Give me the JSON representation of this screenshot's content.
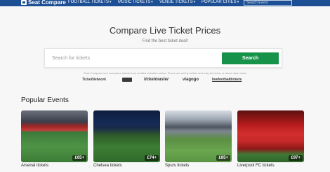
{
  "nav": {
    "logo": "Seat Compare",
    "items": [
      {
        "label": "FOOTBALL TICKETS"
      },
      {
        "label": "MUSIC TICKETS"
      },
      {
        "label": "VENUE TICKETS"
      },
      {
        "label": "POPULAR CITIES"
      }
    ],
    "search_placeholder": "Search Event"
  },
  "hero": {
    "title": "Compare Live Ticket Prices",
    "subtitle": "Find the best ticket deal!",
    "search_placeholder": "Search for tickets",
    "search_button": "Search",
    "disclaimer": "Seat-Compare.com compares tickets from verified websites online. Prices are set by sellers and may be below or above face value"
  },
  "partners": [
    "TicketNetwork",
    "StubHub",
    "ticketmaster",
    "viagogo",
    "livefootballtickets"
  ],
  "popular": {
    "title": "Popular Events",
    "events": [
      {
        "label": "Arsenal tickets",
        "price": "£65+"
      },
      {
        "label": "Chelsea tickets",
        "price": "£74+"
      },
      {
        "label": "Spurs tickets",
        "price": "£85+"
      },
      {
        "label": "Liverpool FC tickets",
        "price": "£97+"
      }
    ]
  },
  "colors": {
    "nav_bg": "#1d4f94",
    "search_button_bg": "#16924a"
  }
}
